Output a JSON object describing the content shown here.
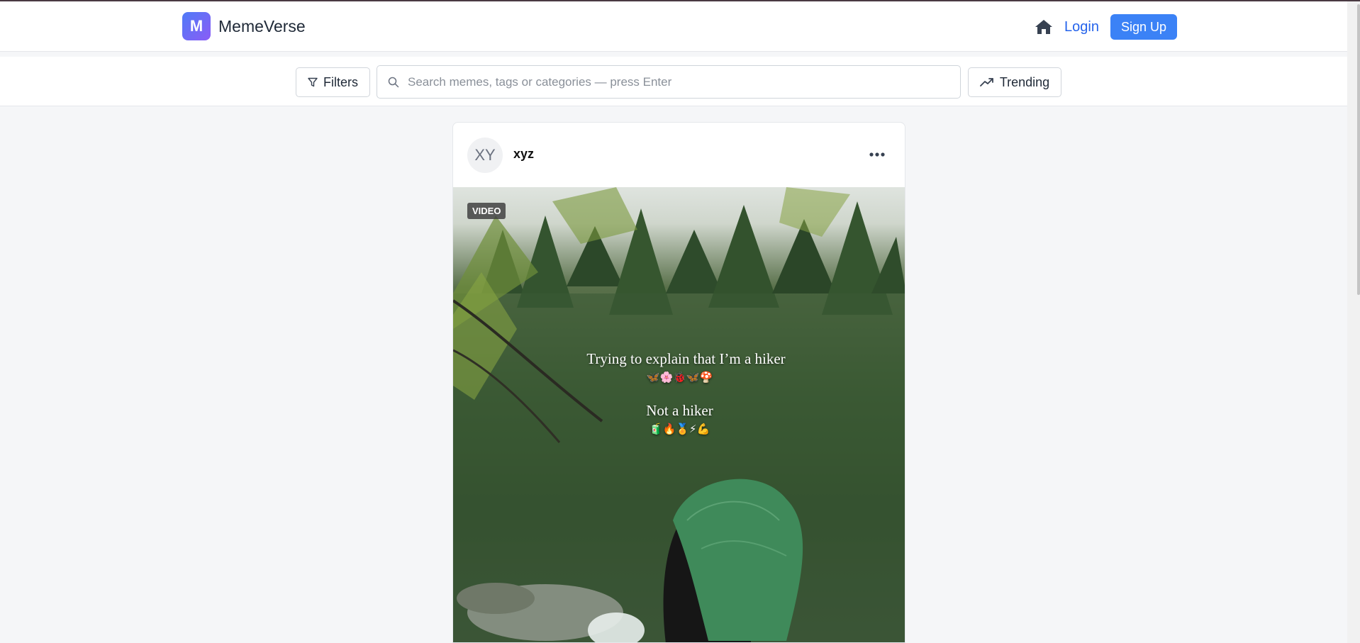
{
  "navbar": {
    "logo_letter": "M",
    "brand_name": "MemeVerse",
    "home_icon": "home-icon",
    "login_label": "Login",
    "signup_label": "Sign Up"
  },
  "toolbar": {
    "filters_label": "Filters",
    "search_placeholder": "Search memes, tags or categories — press Enter",
    "search_value": "",
    "trending_label": "Trending"
  },
  "post": {
    "avatar_initials": "XY",
    "username": "xyz",
    "media_badge": "VIDEO",
    "caption_line1": "Trying to explain that I’m a hiker",
    "caption_emojis1": "🦋🌸🐞🦋🍄",
    "caption_line2": "Not a hiker",
    "caption_emojis2": "🧃🔥🏅⚡💪"
  },
  "colors": {
    "accent": "#3b82f6",
    "link": "#2563eb",
    "logo_gradient_start": "#4f7bf7",
    "logo_gradient_end": "#8b5cf6",
    "page_bg": "#f5f6f8"
  }
}
